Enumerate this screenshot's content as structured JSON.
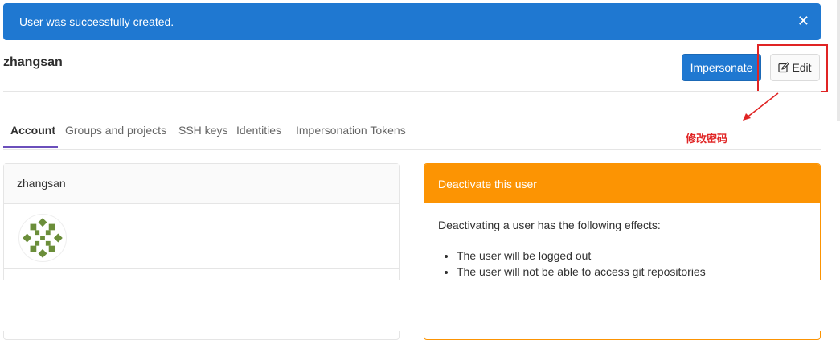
{
  "flash": {
    "message": "User was successfully created.",
    "close_glyph": "✕"
  },
  "user": {
    "username": "zhangsan"
  },
  "header": {
    "impersonate_label": "Impersonate",
    "edit_label": "Edit"
  },
  "tabs": [
    {
      "label": "Account"
    },
    {
      "label": "Groups and projects"
    },
    {
      "label": "SSH keys"
    },
    {
      "label": "Identities"
    },
    {
      "label": "Impersonation Tokens"
    }
  ],
  "annotation": {
    "text": "修改密码",
    "color": "#e02424"
  },
  "profile_panel": {
    "title": "zhangsan"
  },
  "deactivate_panel": {
    "title": "Deactivate this user",
    "intro": "Deactivating a user has the following effects:",
    "effects": [
      "The user will be logged out",
      "The user will not be able to access git repositories"
    ]
  },
  "colors": {
    "primary": "#1f78d1",
    "warning": "#fc9403",
    "tab_active_underline": "#6b4fbb",
    "avatar": "#6b8e3a"
  }
}
